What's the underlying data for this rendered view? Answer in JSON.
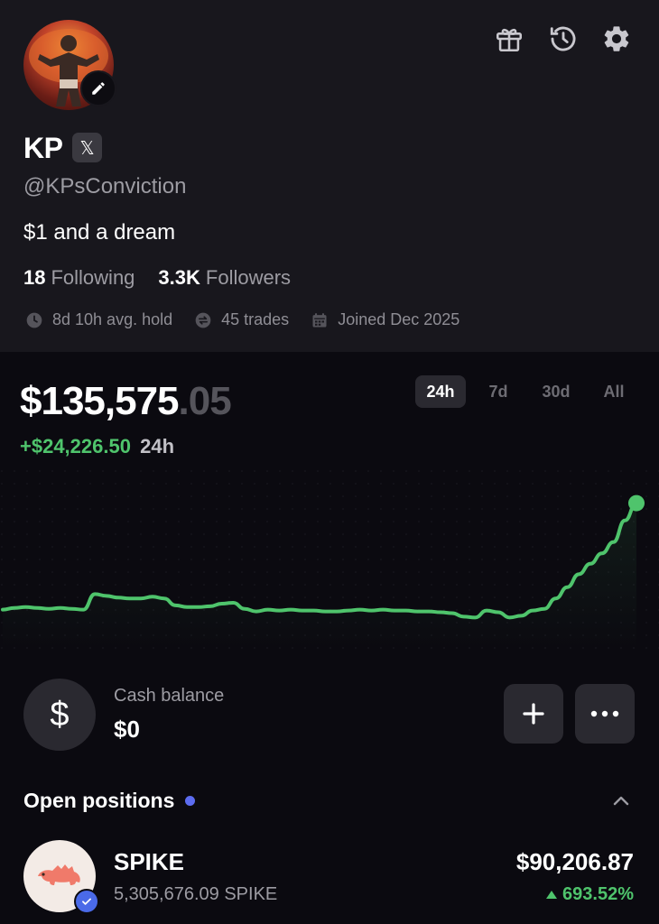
{
  "profile": {
    "name": "KP",
    "x_badge": "𝕏",
    "handle": "@KPsConviction",
    "bio": "$1 and a dream",
    "following_count": "18",
    "following_label": "Following",
    "followers_count": "3.3K",
    "followers_label": "Followers",
    "stats": {
      "avg_hold": "8d 10h avg. hold",
      "trades": "45 trades",
      "joined": "Joined Dec 2025"
    }
  },
  "header_icons": [
    "gift-icon",
    "history-icon",
    "gear-icon"
  ],
  "portfolio": {
    "value_main": "$135,575",
    "value_cents": ".05",
    "change": "+$24,226.50",
    "change_period": "24h",
    "ranges": [
      "24h",
      "7d",
      "30d",
      "All"
    ],
    "active_range": "24h"
  },
  "colors": {
    "accent_green": "#4fc46c",
    "profile_bg": "#18171d",
    "page_bg": "#0b0a10",
    "button_bg": "#2a2930",
    "dot_blue": "#5c6cf0"
  },
  "chart_data": {
    "type": "line",
    "title": "",
    "xlabel": "",
    "ylabel": "",
    "x": [
      0,
      1,
      2,
      3,
      4,
      5,
      6,
      7,
      8,
      9,
      10,
      11,
      12,
      13,
      14,
      15,
      16,
      17,
      18,
      19,
      20,
      21,
      22,
      23,
      24,
      25,
      26,
      27,
      28,
      29,
      30,
      31,
      32,
      33,
      34,
      35,
      36,
      37,
      38,
      39,
      40,
      41,
      42,
      43,
      44,
      45,
      46,
      47,
      48,
      49,
      50,
      51,
      52,
      53,
      54,
      55
    ],
    "values": [
      111700,
      111900,
      112000,
      111900,
      111800,
      111900,
      111800,
      111700,
      113500,
      113300,
      113100,
      113000,
      113000,
      113200,
      113000,
      112200,
      112000,
      112000,
      112100,
      112400,
      112500,
      111800,
      111500,
      111700,
      111600,
      111700,
      111600,
      111600,
      111500,
      111500,
      111600,
      111700,
      111600,
      111700,
      111600,
      111600,
      111500,
      111500,
      111400,
      111300,
      110900,
      110800,
      111600,
      111400,
      110800,
      111000,
      111600,
      111800,
      113000,
      114300,
      115800,
      117000,
      118200,
      119500,
      122000,
      124000
    ]
  },
  "cash": {
    "symbol": "$",
    "label": "Cash balance",
    "value": "$0"
  },
  "buttons": {
    "add": "+",
    "more": "•••"
  },
  "positions": {
    "title": "Open positions",
    "items": [
      {
        "name": "SPIKE",
        "quantity": "5,305,676.09 SPIKE",
        "value": "$90,206.87",
        "change": "693.52%"
      }
    ]
  }
}
